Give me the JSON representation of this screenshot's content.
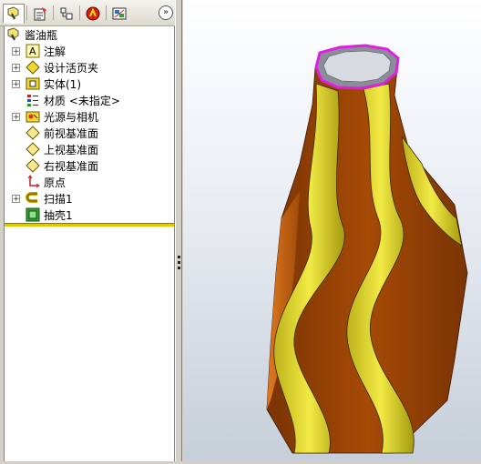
{
  "feature_manager": {
    "tabs": [
      "featuremanager-tab",
      "propertymanager-tab",
      "configuration-tab",
      "appearance-tab",
      "display-manager-tab"
    ],
    "expand_glyph": "»",
    "root": {
      "label": "酱油瓶",
      "icon": "part-icon"
    },
    "items": [
      {
        "label": "注解",
        "icon": "annotations-icon",
        "expandable": true
      },
      {
        "label": "设计活页夹",
        "icon": "design-binder-icon",
        "expandable": true
      },
      {
        "label": "实体(1)",
        "icon": "solid-bodies-icon",
        "expandable": true
      },
      {
        "label": "材质 <未指定>",
        "icon": "material-icon",
        "expandable": false
      },
      {
        "label": "光源与相机",
        "icon": "lights-cameras-icon",
        "expandable": true
      },
      {
        "label": "前视基准面",
        "icon": "plane-icon",
        "expandable": false
      },
      {
        "label": "上视基准面",
        "icon": "plane-icon",
        "expandable": false
      },
      {
        "label": "右视基准面",
        "icon": "plane-icon",
        "expandable": false
      },
      {
        "label": "原点",
        "icon": "origin-icon",
        "expandable": false
      },
      {
        "label": "扫描1",
        "icon": "sweep-icon",
        "expandable": true
      },
      {
        "label": "抽壳1",
        "icon": "shell-icon",
        "expandable": false
      }
    ]
  },
  "colors": {
    "brown": "#a64a06",
    "orange": "#d8701a",
    "yellow": "#d8cf2a",
    "highlight_edge": "#e020e0",
    "rollback_bar": "#e0c800"
  }
}
